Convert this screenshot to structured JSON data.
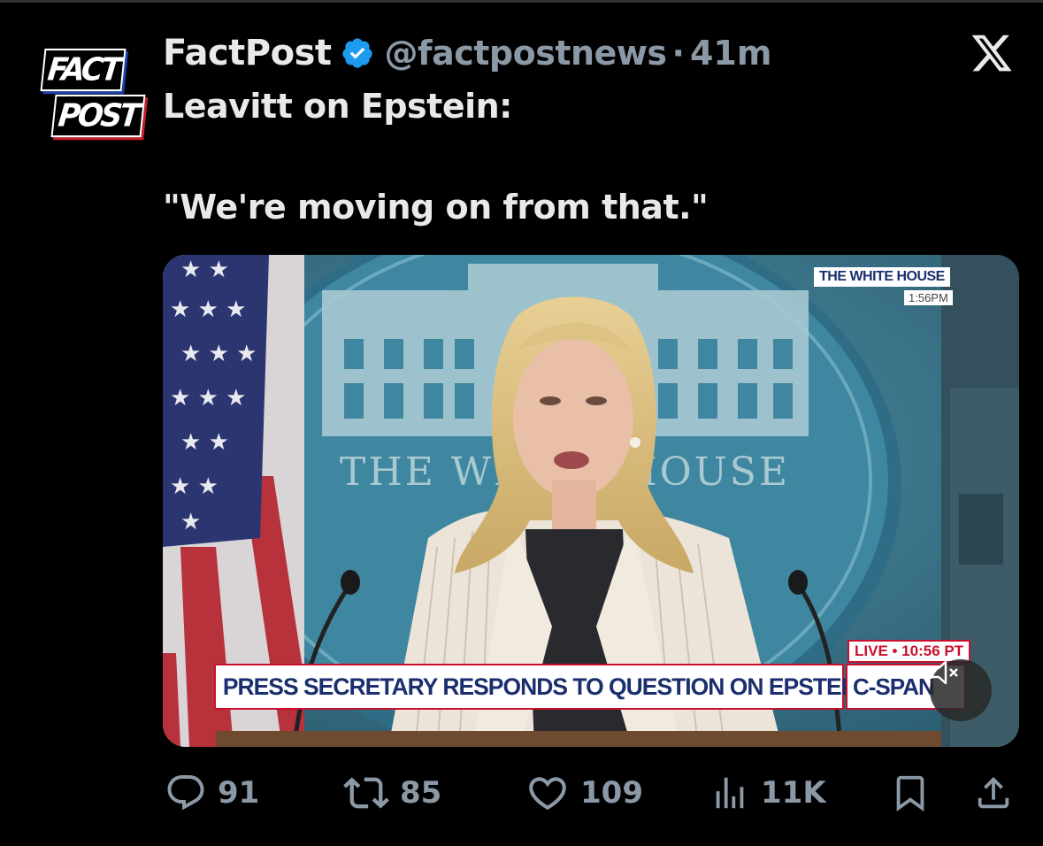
{
  "account": {
    "avatar_logo_text": [
      "FACT",
      "POST"
    ],
    "name": "FactPost",
    "handle": "@factpostnews",
    "separator": "·",
    "time_ago": "41m"
  },
  "post": {
    "line1": "Leavitt on Epstein:",
    "line2": "\"We're moving on from that.\""
  },
  "media": {
    "backdrop_text": "THE WHITE HOUSE",
    "corner_badge_title": "THE WHITE HOUSE",
    "corner_badge_time": "1:56PM",
    "live_tag": "LIVE • 10:56 PT",
    "chyron_text": "PRESS SECRETARY RESPONDS TO QUESTION ON EPSTEIN FILES",
    "network": "C-SPAN",
    "muted": true
  },
  "actions": {
    "replies": "91",
    "reposts": "85",
    "likes": "109",
    "views": "11K"
  },
  "colors": {
    "background": "#000000",
    "text_primary": "#e7e9ea",
    "text_secondary": "#8b98a5",
    "verified_blue": "#1d9bf0"
  },
  "icons": [
    "x-logo-icon",
    "verified-badge-icon",
    "reply-icon",
    "repost-icon",
    "like-icon",
    "views-icon",
    "bookmark-icon",
    "share-icon",
    "mute-icon"
  ]
}
